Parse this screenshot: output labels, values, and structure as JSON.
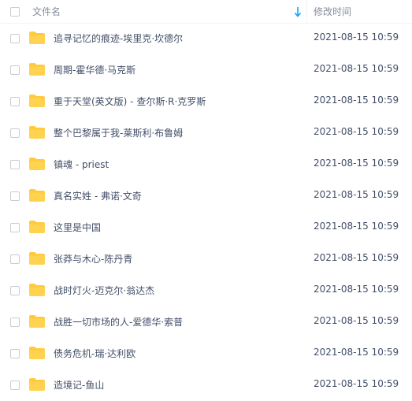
{
  "header": {
    "name_label": "文件名",
    "time_label": "修改时间",
    "sort_icon": "arrow-down-icon"
  },
  "colors": {
    "folder": "#ffcb3d",
    "text": "#424e67",
    "header_text": "#878c9c",
    "sort_arrow": "#06a7ff"
  },
  "files": [
    {
      "name": "追寻记忆的痕迹-埃里克·坎德尔",
      "modified": "2021-08-15 10:59",
      "icon": "folder-icon"
    },
    {
      "name": "周期-霍华德·马克斯",
      "modified": "2021-08-15 10:59",
      "icon": "folder-icon"
    },
    {
      "name": "重于天堂(英文版) - 查尔斯·R·克罗斯",
      "modified": "2021-08-15 10:59",
      "icon": "folder-icon"
    },
    {
      "name": "整个巴黎属于我-莱斯利·布鲁姆",
      "modified": "2021-08-15 10:59",
      "icon": "folder-icon"
    },
    {
      "name": "镇魂 - priest",
      "modified": "2021-08-15 10:59",
      "icon": "folder-icon"
    },
    {
      "name": "真名实姓 - 弗诺·文奇",
      "modified": "2021-08-15 10:59",
      "icon": "folder-icon"
    },
    {
      "name": "这里是中国",
      "modified": "2021-08-15 10:59",
      "icon": "folder-icon"
    },
    {
      "name": "张莽与木心-陈丹青",
      "modified": "2021-08-15 10:59",
      "icon": "folder-icon"
    },
    {
      "name": "战时灯火-迈克尔·翁达杰",
      "modified": "2021-08-15 10:59",
      "icon": "folder-icon"
    },
    {
      "name": "战胜一切市场的人-爱德华·索普",
      "modified": "2021-08-15 10:59",
      "icon": "folder-icon"
    },
    {
      "name": "债务危机-瑞·达利欧",
      "modified": "2021-08-15 10:59",
      "icon": "folder-icon"
    },
    {
      "name": "造境记-鱼山",
      "modified": "2021-08-15 10:59",
      "icon": "folder-icon"
    }
  ]
}
